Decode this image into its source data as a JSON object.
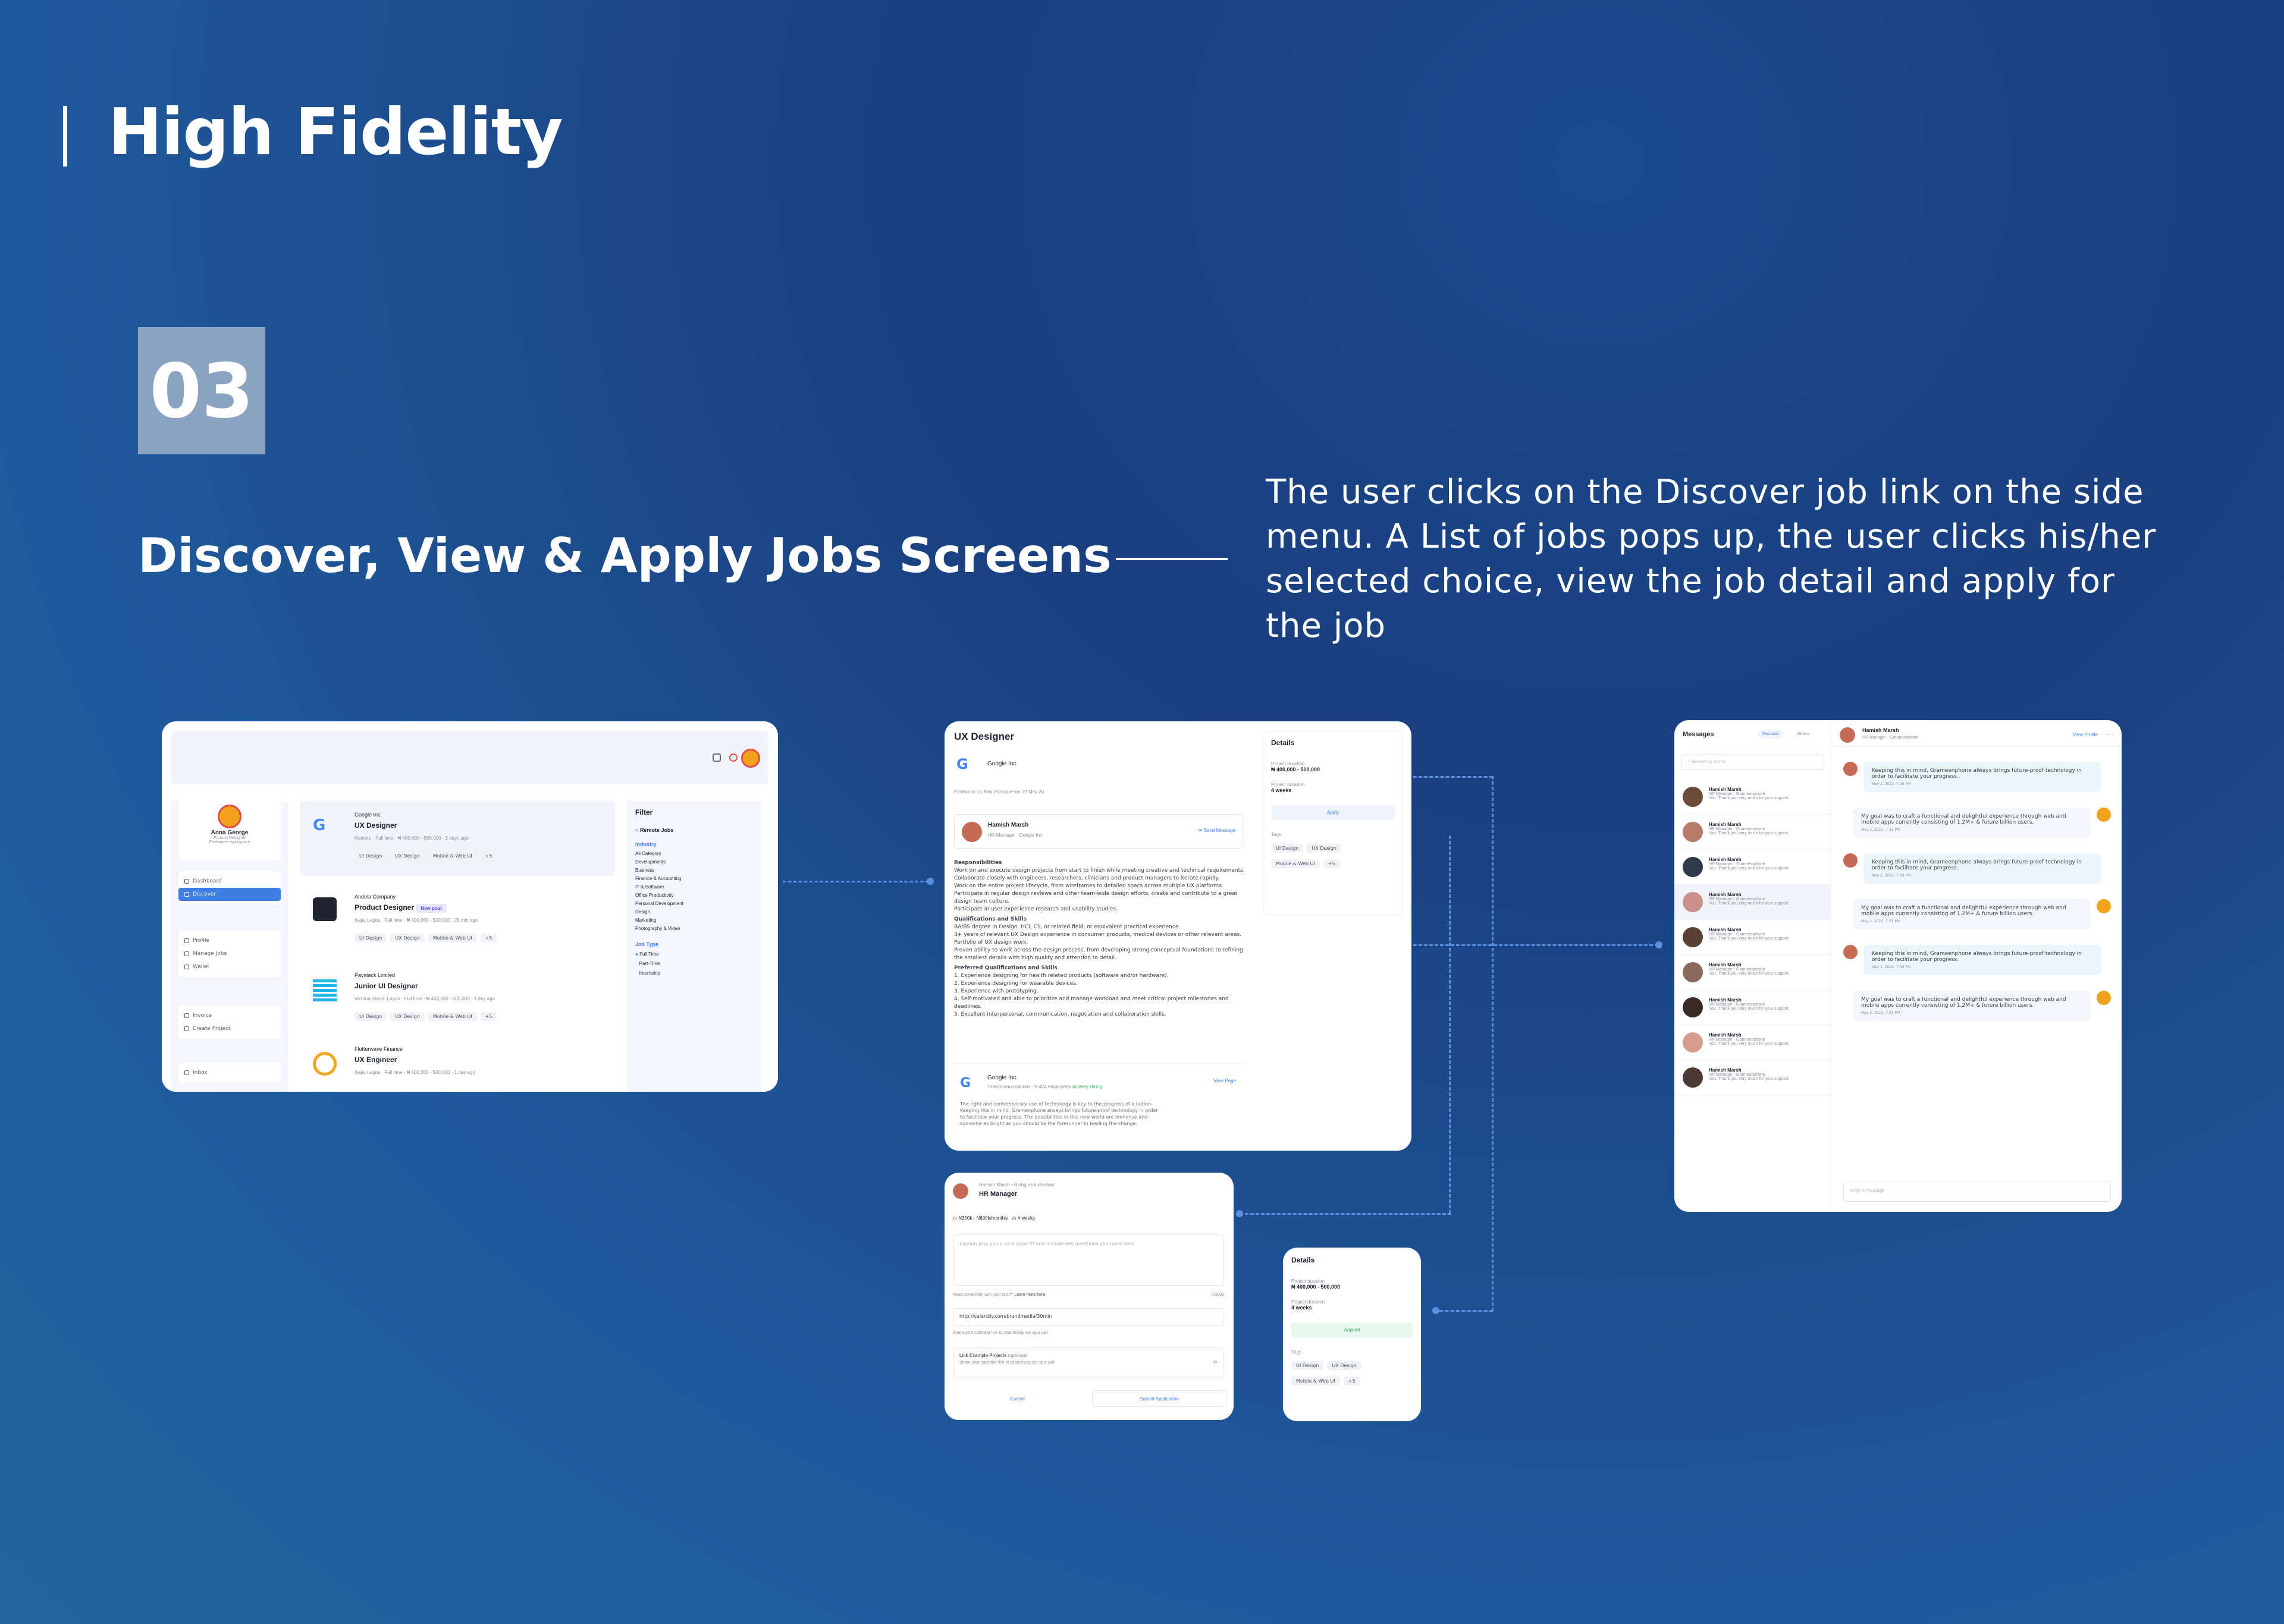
{
  "header": {
    "title": "High Fidelity",
    "number": "03",
    "section_title": "Discover, View & Apply Jobs Screens",
    "description": "The user clicks on the Discover job link on the side menu. A List of jobs pops up, the user clicks his/her selected choice, view the job detail and apply for the job"
  },
  "discover": {
    "profile": {
      "name": "Anna George",
      "role": "Product Designer",
      "workspace": "Freelancer workspace"
    },
    "nav_top": [
      "Dashboard",
      "Discover"
    ],
    "nav_mid": [
      "Profile",
      "Manage Jobs",
      "Wallet"
    ],
    "nav_bottom": [
      "Invoice",
      "Create Project"
    ],
    "nav_last": [
      "Inbox"
    ],
    "jobs": [
      {
        "company": "Google Inc.",
        "title": "UX Designer",
        "meta": [
          "Remote",
          "Full time",
          "₦ 400,000 - 500,000",
          "3 days ago"
        ],
        "tags": [
          "UI Design",
          "UX Design",
          "Mobile & Web UI",
          "+5"
        ]
      },
      {
        "company": "Andela Company",
        "title": "Product Designer",
        "badge": "New post",
        "meta": [
          "Ikeja, Lagos",
          "Full time",
          "₦ 400,000 - 500,000",
          "29 min ago"
        ],
        "tags": [
          "UI Design",
          "UX Design",
          "Mobile & Web UI",
          "+5"
        ]
      },
      {
        "company": "Paystack Limited",
        "title": "Junior UI Designer",
        "meta": [
          "Victoria Island, Lagos",
          "Full time",
          "₦ 400,000 - 500,000",
          "1 day ago"
        ],
        "tags": [
          "UI Design",
          "UX Design",
          "Mobile & Web UI",
          "+5"
        ]
      },
      {
        "company": "Flutterwave Finance",
        "title": "UX Engineer",
        "meta": [
          "Ikeja, Lagos",
          "Full time",
          "₦ 400,000 - 500,000",
          "1 day ago"
        ],
        "tags": []
      }
    ],
    "filter": {
      "title": "Filter",
      "remote": "Remote Jobs",
      "industry_label": "Industry",
      "industries": [
        "All Category",
        "Developments",
        "Business",
        "Finance & Accounting",
        "IT & Software",
        "Office Productivity",
        "Personal Development",
        "Design",
        "Marketing",
        "Photography & Video"
      ],
      "jobtype_label": "Job Type",
      "jobtypes": [
        "Full Time",
        "Part-Time",
        "Internship"
      ]
    }
  },
  "detail": {
    "title": "UX Designer",
    "company": "Google Inc.",
    "posted": "Posted on 15 May 20   Expire on 20 May 20",
    "poster_name": "Hamish Marsh",
    "poster_role": "HR Manager · Google Inc.",
    "send_message": "Send Message",
    "resp_label": "Responsibilities",
    "responsibilities": [
      "Work on and execute design projects from start to finish while meeting creative and technical requirements.",
      "Collaborate closely with engineers, researchers, clinicians and product managers to iterate rapidly.",
      "Work on the entire project lifecycle, from wireframes to detailed specs across multiple UX platforms.",
      "Participate in regular design reviews and other team-wide design efforts, create and contribute to a great design team culture.",
      "Participate in user experience research and usability studies."
    ],
    "qual_label": "Qualifications and Skills",
    "qualifications": [
      "BA/BS degree in Design, HCI, CS, or related field, or equivalent practical experience.",
      "3+ years of relevant UX Design experience in consumer products, medical devices or other relevant areas.",
      "Portfolio of UX design work.",
      "Proven ability to work across the design process, from developing strong conceptual foundations to refining the smallest details with high quality and attention to detail."
    ],
    "pref_label": "Preferred Qualifications and Skills",
    "preferred": [
      "1. Experience designing for health related products (software and/or hardware).",
      "2. Experience designing for wearable devices.",
      "3. Experience with prototyping.",
      "4. Self-motivated and able to prioritize and manage workload and meet critical project milestones and deadlines.",
      "5. Excellent interpersonal, communication, negotiation and collaboration skills."
    ],
    "about_company": "Google Inc.",
    "about_meta": "Telecommunications · 8,424 employees",
    "about_status": "Actively Hiring",
    "view_page": "View Page",
    "about_text": "The right and contemporary use of technology is key to the progress of a nation. Keeping this in mind, Gramenphone always brings future-proof technology in order to facilitate your progress. The possibilities in this new world are immense and someone as bright as you should be the forerunner in leading the change.",
    "details_label": "Details",
    "dur_label1": "Project duration",
    "dur_val1": "₦ 400,000 - 500,000",
    "dur_label2": "Project duration",
    "dur_val2": "4 weeks",
    "apply": "Apply",
    "tags_label": "Tags",
    "tags": [
      "UI Design",
      "UX Design",
      "Mobile & Web UI",
      "+5"
    ]
  },
  "apply": {
    "poster": "Hamish Marsh • Hiring as individual",
    "role": "HR Manager",
    "rate": "N350k - N600k/monthly",
    "weeks": "4 weeks",
    "placeholder": "Explain why you'd be a good fit and include any questions you have here",
    "pitch_help": "Need some help with your pitch?",
    "learn_more": "Learn more here",
    "count": "0/3000",
    "calendly": "http://calendly.com/brandmedia/30min",
    "calendly_help": "Share your calendar link to seamlessly set up a call",
    "link_label": "Link Example Projects",
    "optional": "(optional)",
    "link_help": "Share your calendar link to seamlessly set up a call",
    "cancel": "Cancel",
    "submit": "Submit Application"
  },
  "applied": {
    "details_label": "Details",
    "dur_label1": "Project duration",
    "dur_val1": "₦ 400,000 - 500,000",
    "dur_label2": "Project duration",
    "dur_val2": "4 weeks",
    "applied": "Applied",
    "tags_label": "Tags",
    "tags": [
      "UI Design",
      "UX Design",
      "Mobile & Web UI",
      "+5"
    ]
  },
  "messages": {
    "title": "Messages",
    "tab_focused": "Focused",
    "tab_others": "Others",
    "search_placeholder": "Search by name",
    "items": [
      {
        "name": "Hamish Marsh",
        "role": "HR Manager · Grameenphone",
        "text": "You: Thank you very much for your support."
      },
      {
        "name": "Hamish Marsh",
        "role": "HR Manager · Grameenphone",
        "text": "You: Thank you very much for your support."
      },
      {
        "name": "Hamish Marsh",
        "role": "HR Manager · Grameenphone",
        "text": "You: Thank you very much for your support."
      },
      {
        "name": "Hamish Marsh",
        "role": "HR Manager · Grameenphone",
        "text": "You: Thank you very much for your support."
      },
      {
        "name": "Hamish Marsh",
        "role": "HR Manager · Grameenphone",
        "text": "You: Thank you very much for your support."
      },
      {
        "name": "Hamish Marsh",
        "role": "HR Manager · Grameenphone",
        "text": "You: Thank you very much for your support."
      },
      {
        "name": "Hamish Marsh",
        "role": "HR Manager · Grameenphone",
        "text": "You: Thank you very much for your support."
      },
      {
        "name": "Hamish Marsh",
        "role": "HR Manager · Grameenphone",
        "text": "You: Thank you very much for your support."
      },
      {
        "name": "Hamish Marsh",
        "role": "HR Manager · Grameenphone",
        "text": "You: Thank you very much for your support."
      }
    ],
    "chat_name": "Hamish Marsh",
    "chat_role": "HR Manager · Grameenphone",
    "view_profile": "View Profile",
    "chat": [
      {
        "from": "them",
        "text": "Keeping this in mind, Grameenphone always brings future-proof technology in order to facilitate your progress.",
        "time": "May 2, 2022, 7:30 PM"
      },
      {
        "from": "me",
        "text": "My goal was to craft a functional and delightful experience through web and mobile apps currently consisting of 1.2M+ & future billion users.",
        "time": "May 2, 2022, 7:31 PM"
      },
      {
        "from": "them",
        "text": "Keeping this in mind, Grameenphone always brings future-proof technology in order to facilitate your progress.",
        "time": "May 2, 2022, 7:30 PM"
      },
      {
        "from": "me",
        "text": "My goal was to craft a functional and delightful experience through web and mobile apps currently consisting of 1.2M+ & future billion users.",
        "time": "May 2, 2022, 7:31 PM"
      },
      {
        "from": "them",
        "text": "Keeping this in mind, Grameenphone always brings future-proof technology in order to facilitate your progress.",
        "time": "May 2, 2022, 7:30 PM"
      },
      {
        "from": "me",
        "text": "My goal was to craft a functional and delightful experience through web and mobile apps currently consisting of 1.2M+ & future billion users.",
        "time": "May 2, 2022, 7:31 PM"
      }
    ],
    "input_placeholder": "Write a message"
  },
  "colors": {
    "accent": "#3e7fe6",
    "applied_green": "#3fb36b",
    "background": "#1b4a8f"
  }
}
